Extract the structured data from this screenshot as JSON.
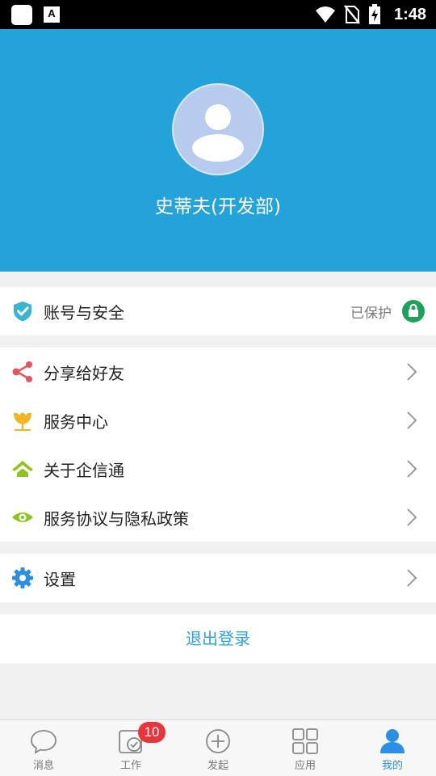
{
  "status_bar": {
    "time": "1:48",
    "keyboard_indicator": "A"
  },
  "profile": {
    "name": "史蒂夫(开发部)"
  },
  "account_security": {
    "label": "账号与安全",
    "status": "已保护",
    "icon": "shield-check-icon",
    "status_color": "#1ea25b"
  },
  "menu": [
    {
      "label": "分享给好友",
      "icon": "share-icon",
      "color": "#e4565f"
    },
    {
      "label": "服务中心",
      "icon": "service-center-icon",
      "color": "#f1b52a"
    },
    {
      "label": "关于企信通",
      "icon": "home-icon",
      "color": "#8fc31f"
    },
    {
      "label": "服务协议与隐私政策",
      "icon": "eye-icon",
      "color": "#8fc31f"
    }
  ],
  "settings": {
    "label": "设置",
    "icon": "gear-icon",
    "color": "#2a8fe0"
  },
  "logout": {
    "label": "退出登录"
  },
  "bottom_nav": {
    "tabs": [
      {
        "label": "消息",
        "icon": "chat-bubble-icon",
        "active": false
      },
      {
        "label": "工作",
        "icon": "work-check-icon",
        "active": false,
        "badge": "10"
      },
      {
        "label": "发起",
        "icon": "plus-circle-icon",
        "active": false
      },
      {
        "label": "应用",
        "icon": "grid-apps-icon",
        "active": false
      },
      {
        "label": "我的",
        "icon": "user-icon",
        "active": true
      }
    ],
    "accent": "#2d8fe3"
  },
  "colors": {
    "header_bg": "#24a3da",
    "page_bg": "#f0f0f0",
    "logout_text": "#2da0db"
  }
}
